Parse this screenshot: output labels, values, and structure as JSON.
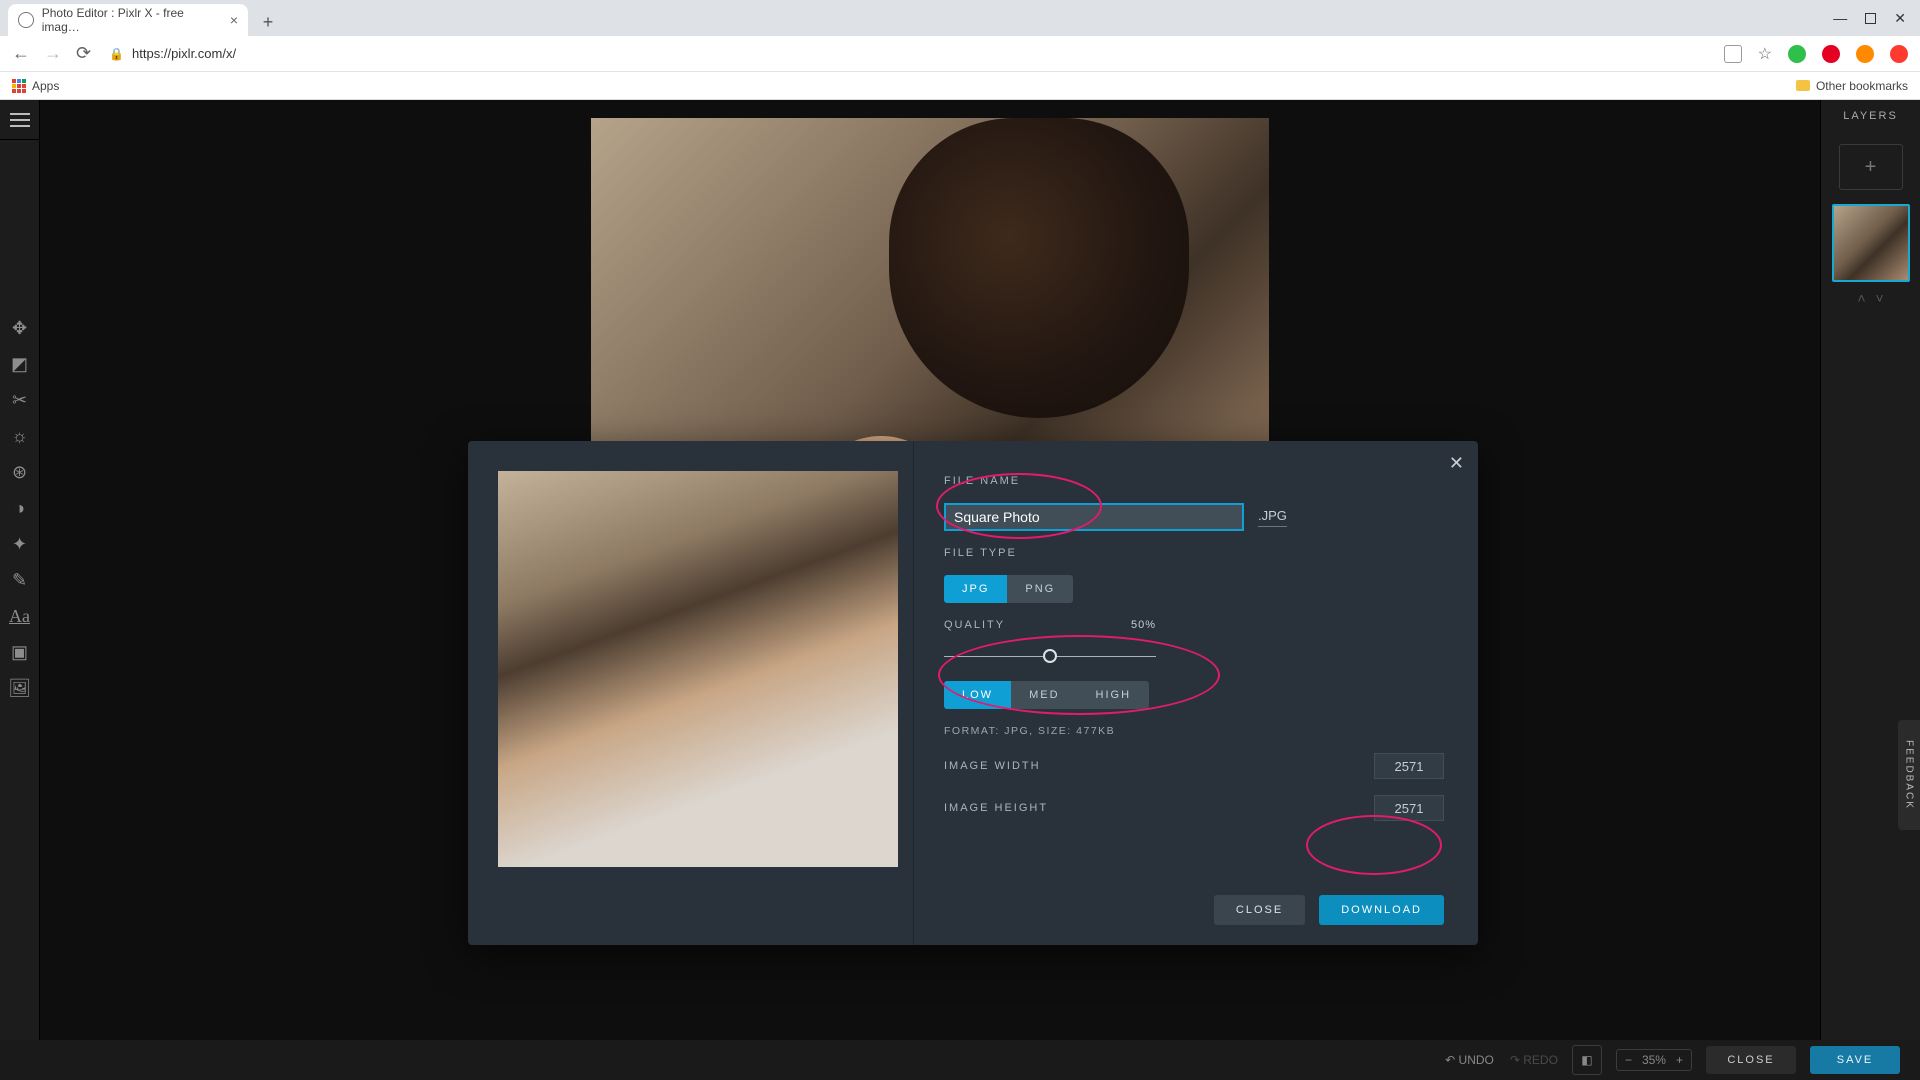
{
  "browser": {
    "tab_title": "Photo Editor : Pixlr X - free imag…",
    "url": "https://pixlr.com/x/",
    "apps_label": "Apps",
    "other_bookmarks": "Other bookmarks"
  },
  "app": {
    "layers_header": "LAYERS",
    "feedback": "FEEDBACK",
    "undo": "UNDO",
    "redo": "REDO",
    "zoom_pct": "35%",
    "close": "CLOSE",
    "save": "SAVE"
  },
  "dialog": {
    "file_name_label": "FILE NAME",
    "file_name_value": "Square Photo",
    "ext_label": ".JPG",
    "file_type_label": "FILE TYPE",
    "jpg": "JPG",
    "png": "PNG",
    "quality_label": "QUALITY",
    "quality_pct": "50%",
    "low": "LOW",
    "med": "MED",
    "high": "HIGH",
    "format_meta": "FORMAT: JPG, SIZE: 477KB",
    "width_label": "IMAGE WIDTH",
    "width_value": "2571",
    "height_label": "IMAGE HEIGHT",
    "height_value": "2571",
    "close": "CLOSE",
    "download": "DOWNLOAD"
  }
}
